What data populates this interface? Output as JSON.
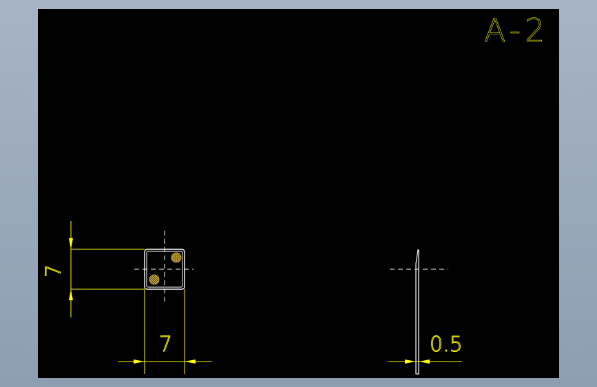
{
  "drawing": {
    "sheet_label": "A-2",
    "dim_height_left": "7",
    "dim_width_bottom": "7",
    "dim_thickness": "0.5"
  },
  "colors": {
    "background_outer": "#98a7bb",
    "canvas": "#000000",
    "geometry": "#ffffff",
    "annotation": "#ffff00",
    "hatch": "#c8a53a"
  }
}
